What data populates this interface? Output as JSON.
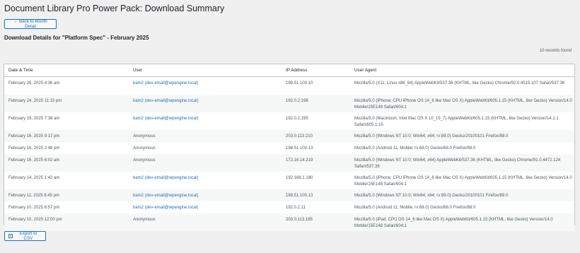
{
  "page_title": "Document Library Pro Power Pack: Download Summary",
  "back_button": {
    "label": "← Back to Month Detail"
  },
  "subtitle": "Download Details for \"Platform Spec\" - February 2025",
  "records_count": "10 records found",
  "table": {
    "headers": [
      "Date & Time",
      "User",
      "IP Address",
      "User Agent"
    ],
    "rows": [
      {
        "date": "February 26, 2025 4:36 am",
        "user": "bam2 (dev-email@wpengine.local)",
        "user_type": "link",
        "ip": "198.51.100.10",
        "ua": "Mozilla/5.0 (X11; Linux x86_64) AppleWebKit/537.36 (KHTML, like Gecko) Chrome/92.0.4515.107 Safari/537.36"
      },
      {
        "date": "February 24, 2025 11:15 pm",
        "user": "bam2 (dev-email@wpengine.local)",
        "user_type": "link",
        "ip": "192.0.2.196",
        "ua": "Mozilla/5.0 (iPhone; CPU iPhone OS 14_6 like Mac OS X) AppleWebKit/605.1.15 (KHTML, like Gecko) Version/14.0 Mobile/15E148 Safari/604.1"
      },
      {
        "date": "February 19, 2025 7:38 am",
        "user": "bam2 (dev-email@wpengine.local)",
        "user_type": "link",
        "ip": "192.0.2.195",
        "ua": "Mozilla/5.0 (Macintosh; Intel Mac OS X 10_15_7) AppleWebKit/605.1.15 (KHTML, like Gecko) Version/14.1.1 Safari/605.1.15"
      },
      {
        "date": "February 16, 2025 9:17 pm",
        "user": "Anonymous",
        "user_type": "anon",
        "ip": "203.0.113.210",
        "ua": "Mozilla/5.0 (Windows NT 10.0; Win64; x64; rv:89.0) Gecko/20100101 Firefox/89.0"
      },
      {
        "date": "February 16, 2025 2:48 pm",
        "user": "Anonymous",
        "user_type": "anon",
        "ip": "198.51.100.13",
        "ua": "Mozilla/5.0 (Android 11; Mobile; rv:68.0) Gecko/68.0 Firefox/88.0"
      },
      {
        "date": "February 16, 2025 6:02 am",
        "user": "Anonymous",
        "user_type": "anon",
        "ip": "172.16.14.219",
        "ua": "Mozilla/5.0 (Windows NT 10.0; Win64; x64) AppleWebKit/537.36 (KHTML, like Gecko) Chrome/91.0.4472.124 Safari/537.36"
      },
      {
        "date": "February 14, 2025 1:42 am",
        "user": "bam2 (dev-email@wpengine.local)",
        "user_type": "link",
        "ip": "192.168.1.180",
        "ua": "Mozilla/5.0 (iPhone; CPU iPhone OS 14_6 like Mac OS X) AppleWebKit/605.1.15 (KHTML, like Gecko) Version/14.0 Mobile/15E148 Safari/604.1"
      },
      {
        "date": "February 11, 2025 8:45 pm",
        "user": "bam2 (dev-email@wpengine.local)",
        "user_type": "link",
        "ip": "198.51.100.13",
        "ua": "Mozilla/5.0 (Windows NT 10.0; Win64; x64; rv:89.0) Gecko/20100101 Firefox/89.0"
      },
      {
        "date": "February 10, 2025 6:57 pm",
        "user": "bam2 (dev-email@wpengine.local)",
        "user_type": "link",
        "ip": "192.0.2.11",
        "ua": "Mozilla/5.0 (Android 11; Mobile; rv:68.0) Gecko/68.0 Firefox/88.0"
      },
      {
        "date": "February 10, 2025 12:00 pm",
        "user": "Anonymous",
        "user_type": "anon",
        "ip": "203.0.113.185",
        "ua": "Mozilla/5.0 (iPad; CPU OS 14_6 like Mac OS X) AppleWebKit/605.1.15 (KHTML, like Gecko) Version/14.0 Mobile/15E148 Safari/604.1"
      }
    ]
  },
  "export_button": {
    "label": "Export to CSV",
    "icon": "download-icon"
  },
  "colors": {
    "accent": "#2271b1",
    "background": "#f0f0f1",
    "alt_row": "#f6f7f7"
  }
}
